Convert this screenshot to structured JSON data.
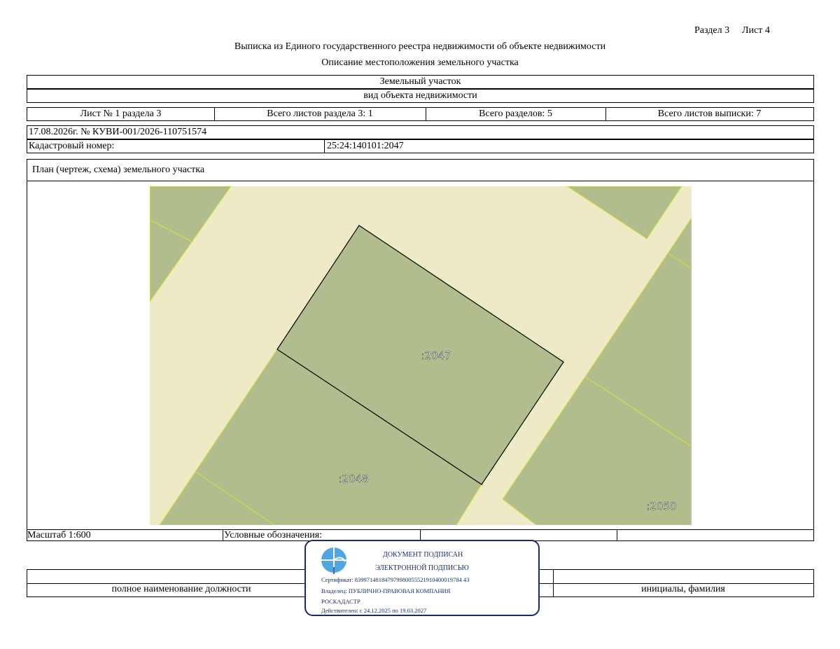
{
  "header": {
    "section_label": "Раздел 3",
    "sheet_label": "Лист 4",
    "title": "Выписка из Единого государственного реестра недвижимости об объекте недвижимости",
    "subtitle": "Описание местоположения земельного участка"
  },
  "object": {
    "type": "Земельный участок",
    "type_caption": "вид объекта недвижимости"
  },
  "sheet_info": {
    "sheet_no": "Лист № 1 раздела 3",
    "total_sheets_section": "Всего листов раздела 3: 1",
    "total_sections": "Всего разделов: 5",
    "total_sheets_extract": "Всего листов выписки: 7"
  },
  "extract": {
    "date_number": "17.08.2026г. № КУВИ-001/2026-110751574",
    "cadastral_label": "Кадастровый номер:",
    "cadastral_value": "25:24:140101:2047"
  },
  "plan": {
    "title": "План (чертеж, схема) земельного участка",
    "labels": {
      "main": ":2047",
      "south": ":2048",
      "east": ":2050"
    },
    "colors": {
      "parcel_fill": "#b1bd8c",
      "background_fill": "#efeac6",
      "boundary_yellow": "#d7e040",
      "outline": "#000000"
    }
  },
  "footer": {
    "scale": "Масштаб 1:600",
    "legend_label": "Условные обозначения:",
    "position_caption": "полное наименование должности",
    "name_caption": "инициалы, фамилия"
  },
  "stamp": {
    "line1": "ДОКУМЕНТ ПОДПИСАН",
    "line2": "ЭЛЕКТРОННОЙ ПОДПИСЬЮ",
    "certificate": "Сертификат: 839971481847979980055521910400019784 43",
    "owner_line1": "Владелец: ПУБЛИЧНО-ПРАВОВАЯ КОМПАНИЯ",
    "owner_line2": "РОСКАДАСТР",
    "valid": "Действителен: с 24.12.2025 по 19.03.2027",
    "border_color": "#1b2a6b",
    "emblem_color": "#4fa6e0"
  }
}
